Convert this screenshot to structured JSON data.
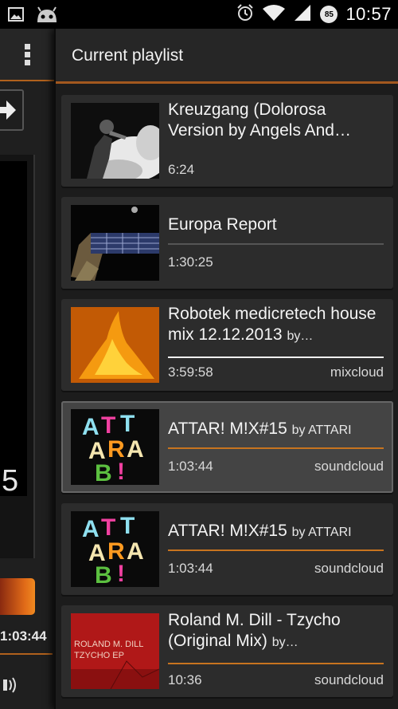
{
  "status_bar": {
    "time": "10:57",
    "battery": "85",
    "icons": [
      "picture-icon",
      "android-icon",
      "alarm-icon",
      "wifi-icon",
      "signal-icon",
      "battery-icon"
    ]
  },
  "background_panel": {
    "big_digit": "5",
    "time": "1:03:44"
  },
  "panel": {
    "title": "Current playlist"
  },
  "playlist": [
    {
      "title": "Kreuzgang (Dolorosa Version by Angels And…",
      "by": "",
      "duration": "6:24",
      "source": "",
      "active": false
    },
    {
      "title": "Europa Report",
      "by": "",
      "duration": "1:30:25",
      "source": "",
      "active": false
    },
    {
      "title": "Robotek medicretech house mix 12.12.2013",
      "by": "by…",
      "duration": "3:59:58",
      "source": "mixcloud",
      "active": false
    },
    {
      "title": "ATTAR! M!X#15",
      "by": "by ATTARI",
      "duration": "1:03:44",
      "source": "soundcloud",
      "active": true
    },
    {
      "title": "ATTAR! M!X#15",
      "by": "by ATTARI",
      "duration": "1:03:44",
      "source": "soundcloud",
      "active": false
    },
    {
      "title": "Roland M. Dill - Tzycho (Original Mix)",
      "by": "by…",
      "duration": "10:36",
      "source": "soundcloud",
      "active": false
    }
  ],
  "thumb_texts": {
    "roland_line1": "ROLAND M. DILL",
    "roland_line2": "TZYCHO EP"
  },
  "colors": {
    "accent": "#b0611d",
    "separator_white": "#f0f0f0",
    "separator_orange": "#c8741f",
    "card_bg": "#2c2c2c",
    "card_active_bg": "#444444"
  }
}
